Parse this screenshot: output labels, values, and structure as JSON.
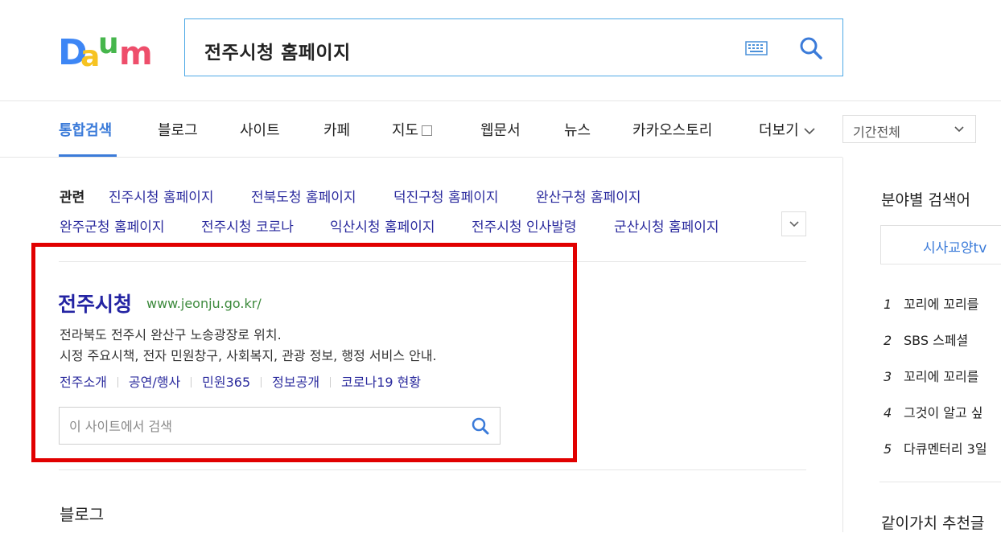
{
  "header": {
    "logo_text": "Daum",
    "search_query": "전주시청 홈페이지",
    "colors": {
      "blue": "#3b7bd9",
      "search_border": "#4ea9e6"
    }
  },
  "tabs": [
    {
      "label": "통합검색",
      "active": true
    },
    {
      "label": "블로그"
    },
    {
      "label": "사이트"
    },
    {
      "label": "카페"
    },
    {
      "label": "지도"
    },
    {
      "label": "웹문서"
    },
    {
      "label": "뉴스"
    },
    {
      "label": "카카오스토리"
    },
    {
      "label": "더보기"
    }
  ],
  "period_select": {
    "value": "기간전체"
  },
  "related": {
    "label": "관련",
    "items": [
      "진주시청 홈페이지",
      "전북도청 홈페이지",
      "덕진구청 홈페이지",
      "완산구청 홈페이지",
      "완주군청 홈페이지",
      "전주시청 코로나",
      "익산시청 홈페이지",
      "전주시청 인사발령",
      "군산시청 홈페이지"
    ]
  },
  "result": {
    "title": "전주시청",
    "url": "www.jeonju.go.kr/",
    "desc_line1": "전라북도 전주시 완산구 노송광장로 위치.",
    "desc_line2": "시정 주요시책, 전자 민원창구, 사회복지, 관광 정보, 행정 서비스 안내.",
    "sublinks": [
      "전주소개",
      "공연/행사",
      "민원365",
      "정보공개",
      "코로나19 현황"
    ],
    "site_search_placeholder": "이 사이트에서 검색",
    "highlight_color": "#e10000"
  },
  "blog_heading": "블로그",
  "right": {
    "title": "분야별 검색어",
    "tab": "시사교양tv",
    "ranks": [
      {
        "num": "1",
        "text": "꼬리에 꼬리를"
      },
      {
        "num": "2",
        "text": "SBS 스페셜"
      },
      {
        "num": "3",
        "text": "꼬리에 꼬리를"
      },
      {
        "num": "4",
        "text": "그것이 알고 싶"
      },
      {
        "num": "5",
        "text": "다큐멘터리 3일"
      }
    ],
    "title2": "같이가치 추천글"
  }
}
